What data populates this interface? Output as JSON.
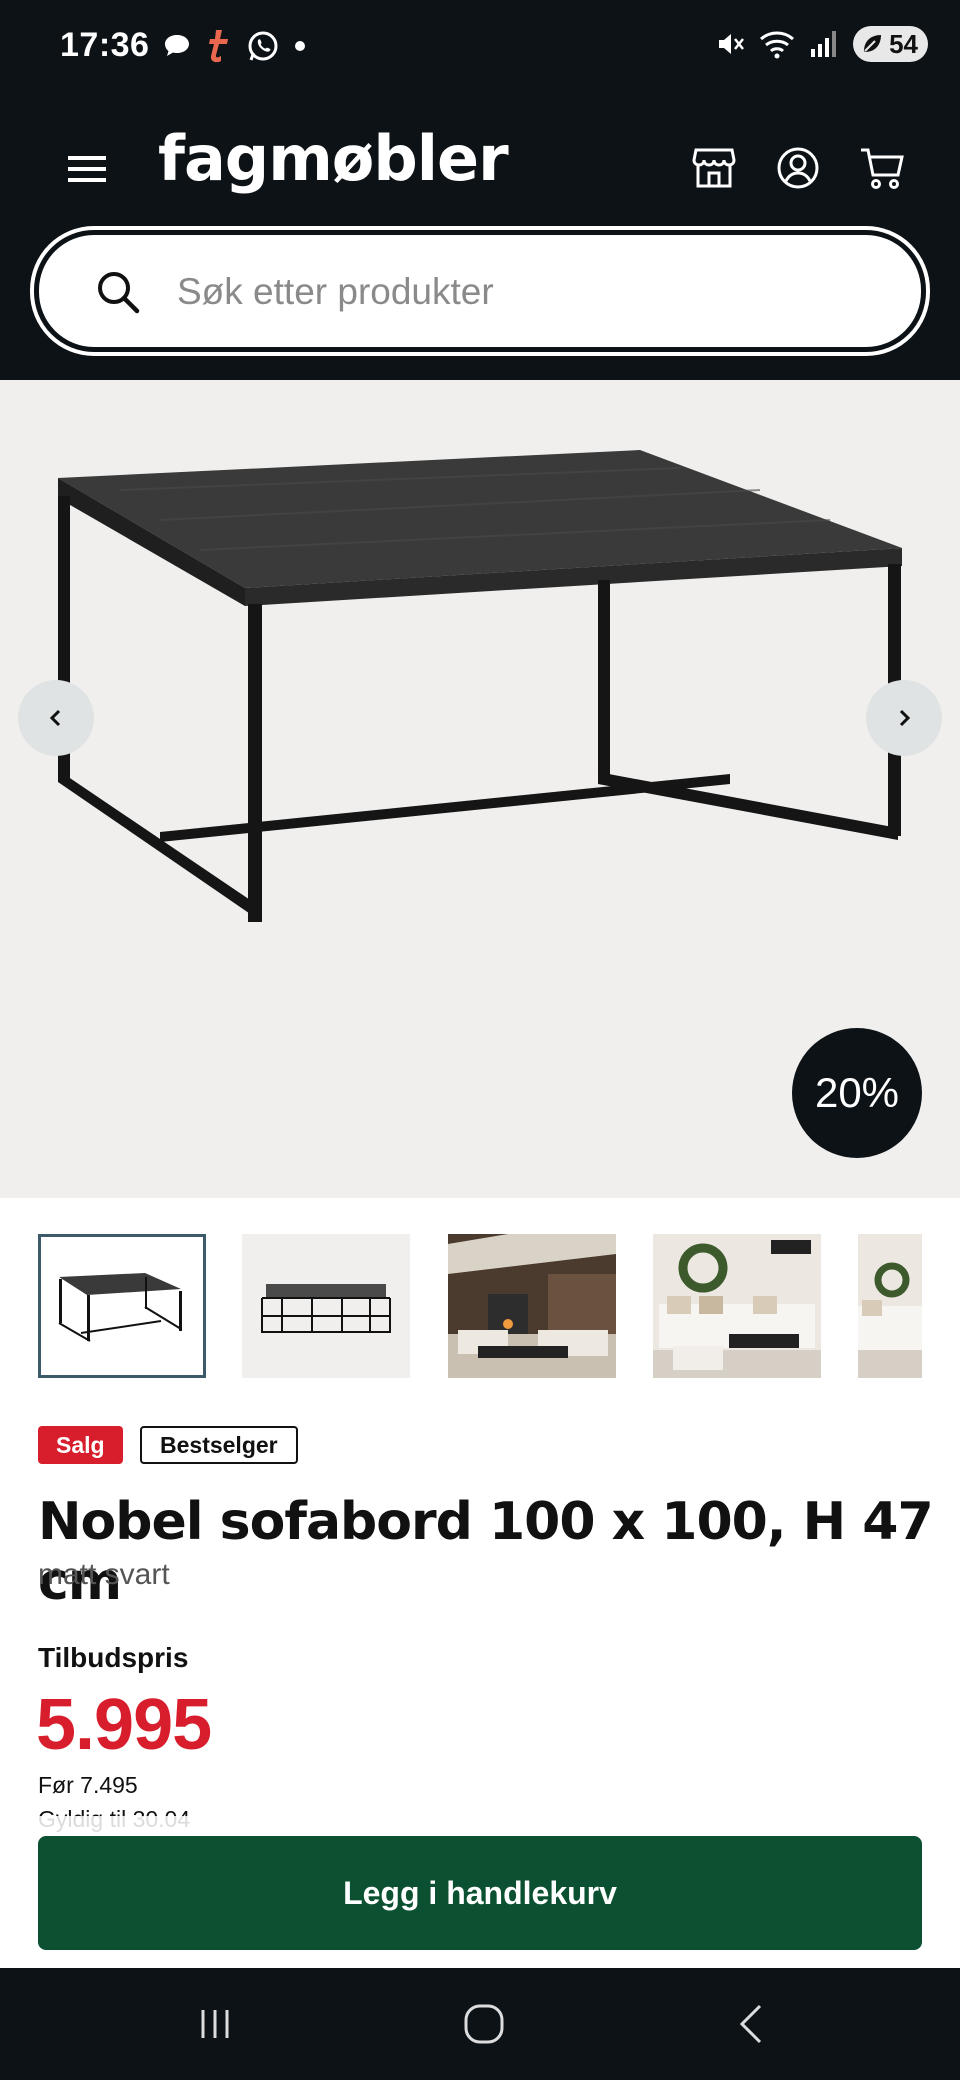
{
  "status_bar": {
    "time": "17:36",
    "battery": "54",
    "left_icons": [
      "chat-bubble-icon",
      "t-app-icon",
      "whatsapp-icon",
      "dot-icon"
    ],
    "right_icons": [
      "mute-icon",
      "wifi-icon",
      "signal-icon",
      "battery-icon"
    ]
  },
  "header": {
    "logo": "fagmøbler",
    "icons": [
      "menu-icon",
      "store-icon",
      "account-icon",
      "cart-icon"
    ],
    "search": {
      "placeholder": "Søk etter produkter"
    }
  },
  "hero": {
    "discount": "20%",
    "prev_icon": "chevron-left-icon",
    "next_icon": "chevron-right-icon"
  },
  "thumbnails": [
    {
      "name": "table-front-view",
      "active": true
    },
    {
      "name": "table-nested-set",
      "active": false
    },
    {
      "name": "living-room-cabin",
      "active": false
    },
    {
      "name": "living-room-white-sofa",
      "active": false
    },
    {
      "name": "living-room-white-sofa-partial",
      "active": false
    }
  ],
  "badges": {
    "sale": "Salg",
    "bestseller": "Bestselger"
  },
  "product": {
    "title": "Nobel sofabord 100 x 100, H 47 cm",
    "variant": "matt svart"
  },
  "pricing": {
    "label": "Tilbudspris",
    "price": "5.995",
    "before": "Før 7.495",
    "valid": "Gyldig til 30.04"
  },
  "cart": {
    "button_label": "Legg i handlekurv"
  },
  "colors": {
    "header_bg": "#0c1216",
    "sale_red": "#d81e2c",
    "cart_green": "#0b5131",
    "hero_bg": "#f0efed"
  },
  "nav_bar": {
    "icons": [
      "recent-apps-icon",
      "home-icon",
      "back-icon"
    ]
  }
}
